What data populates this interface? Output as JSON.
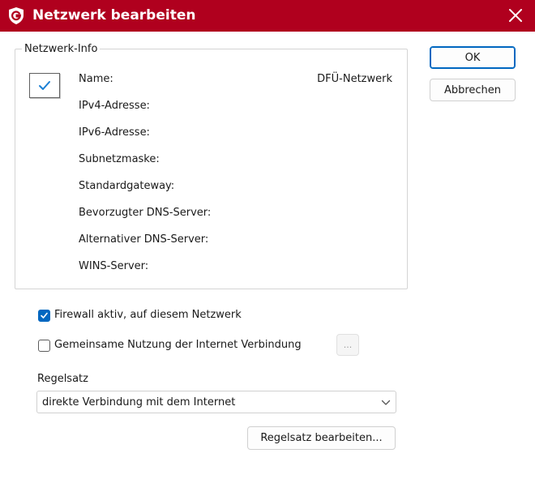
{
  "window": {
    "title": "Netzwerk bearbeiten",
    "accent_color": "#b0001e",
    "logo_icon": "g-data-shield-logo",
    "close_icon": "close-icon"
  },
  "network_info": {
    "group_label": "Netzwerk-Info",
    "icon": "checkmark-icon",
    "rows": [
      {
        "label": "Name:",
        "value": "DFÜ-Netzwerk"
      },
      {
        "label": "IPv4-Adresse:",
        "value": ""
      },
      {
        "label": "IPv6-Adresse:",
        "value": ""
      },
      {
        "label": "Subnetzmaske:",
        "value": ""
      },
      {
        "label": "Standardgateway:",
        "value": ""
      },
      {
        "label": "Bevorzugter DNS-Server:",
        "value": ""
      },
      {
        "label": "Alternativer DNS-Server:",
        "value": ""
      },
      {
        "label": "WINS-Server:",
        "value": ""
      }
    ]
  },
  "buttons": {
    "ok": "OK",
    "cancel": "Abbrechen",
    "ellipsis": "...",
    "edit_ruleset": "Regelsatz bearbeiten..."
  },
  "options": {
    "firewall_active": {
      "label": "Firewall aktiv, auf diesem Netzwerk",
      "checked": true
    },
    "shared_internet": {
      "label": "Gemeinsame Nutzung der Internet Verbindung",
      "checked": false
    }
  },
  "ruleset": {
    "label": "Regelsatz",
    "selected": "direkte Verbindung mit dem Internet"
  }
}
